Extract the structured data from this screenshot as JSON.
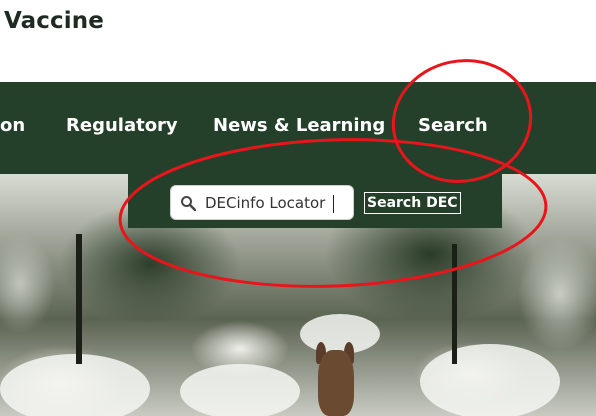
{
  "header": {
    "title": "Vaccine"
  },
  "nav": {
    "items": [
      {
        "label": "on"
      },
      {
        "label": "Regulatory"
      },
      {
        "label": "News & Learning"
      },
      {
        "label": "Search"
      }
    ]
  },
  "search": {
    "value": "DECinfo Locator",
    "button_label": "Search DEC"
  },
  "colors": {
    "nav_background": "#25402a",
    "nav_text": "#ffffff",
    "annotation": "#e8151b"
  },
  "icons": {
    "search": "magnifier-icon"
  }
}
